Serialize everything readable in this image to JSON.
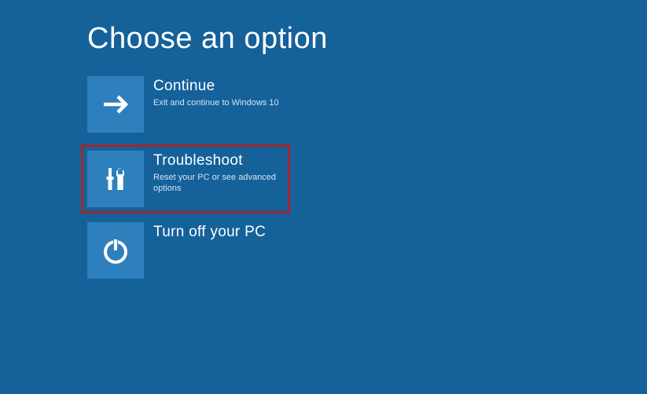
{
  "title": "Choose an option",
  "options": {
    "continue": {
      "title": "Continue",
      "desc": "Exit and continue to Windows 10"
    },
    "troubleshoot": {
      "title": "Troubleshoot",
      "desc": "Reset your PC or see advanced options"
    },
    "turnoff": {
      "title": "Turn off your PC",
      "desc": ""
    }
  },
  "colors": {
    "background": "#15619a",
    "tile": "#2e80bd",
    "highlight": "#a3262e"
  }
}
